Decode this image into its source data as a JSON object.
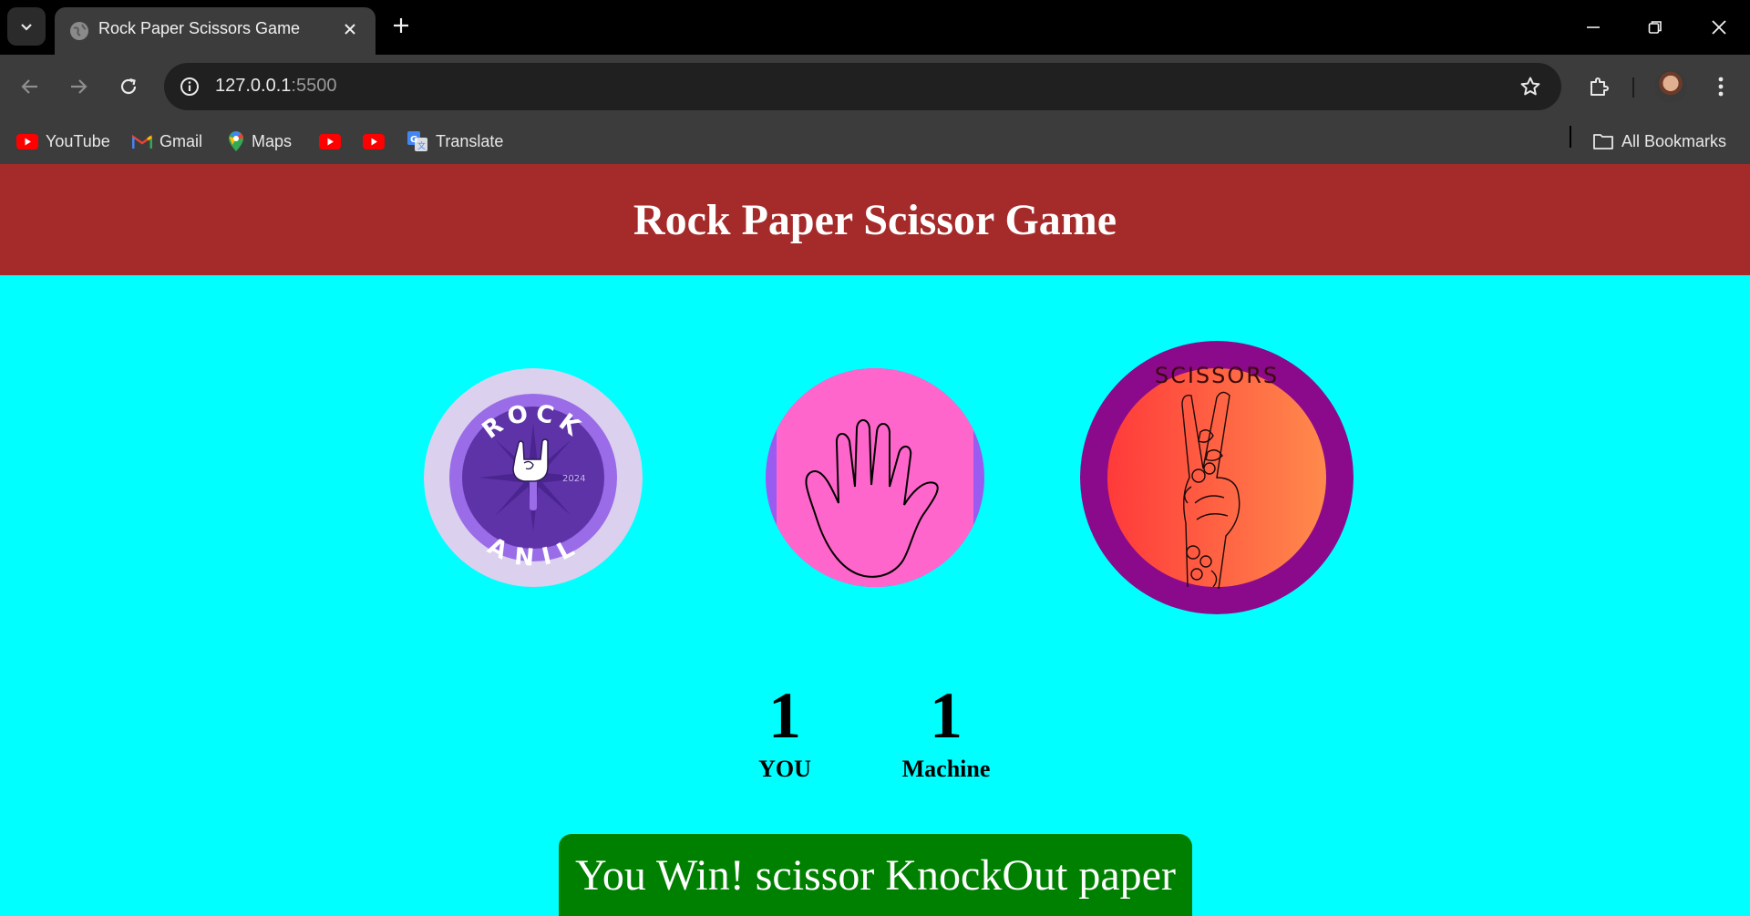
{
  "browser": {
    "tab_title": "Rock Paper Scissors Game",
    "url_host": "127.0.0.1",
    "url_port": ":5500",
    "bookmarks": [
      {
        "label": "YouTube",
        "icon": "youtube-icon"
      },
      {
        "label": "Gmail",
        "icon": "gmail-icon"
      },
      {
        "label": "Maps",
        "icon": "maps-icon"
      },
      {
        "label": "",
        "icon": "youtube-icon"
      },
      {
        "label": "",
        "icon": "youtube-icon"
      },
      {
        "label": "Translate",
        "icon": "translate-icon"
      }
    ],
    "all_bookmarks_label": "All Bookmarks"
  },
  "page": {
    "title": "Rock Paper Scissor Game",
    "choices": [
      {
        "id": "rock",
        "badge_text": "ROCK",
        "badge_name": "ANIL",
        "badge_year": "2024"
      },
      {
        "id": "paper"
      },
      {
        "id": "scissors",
        "badge_text": "SCISSORS"
      }
    ],
    "scores": {
      "you": {
        "value": "1",
        "label": "YOU"
      },
      "machine": {
        "value": "1",
        "label": "Machine"
      }
    },
    "message": "You Win! scissor KnockOut paper"
  },
  "colors": {
    "header_bg": "#a52a2a",
    "page_bg": "#00ffff",
    "message_bg": "#008000"
  }
}
